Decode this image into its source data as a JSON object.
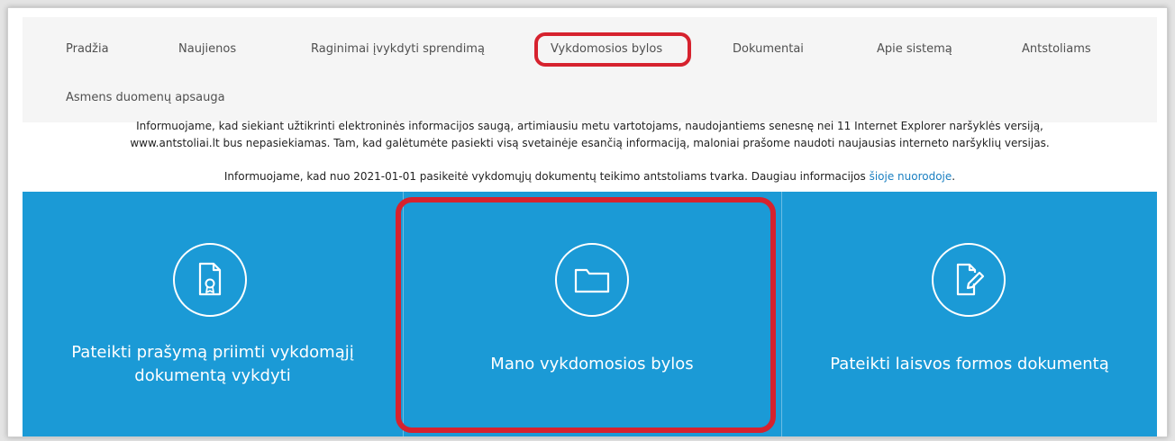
{
  "nav": {
    "items": [
      "Pradžia",
      "Naujienos",
      "Raginimai įvykdyti sprendimą",
      "Vykdomosios bylos",
      "Dokumentai",
      "Apie sistemą",
      "Antstoliams",
      "Asmens duomenų apsauga"
    ],
    "highlighted": "Vykdomosios bylos"
  },
  "notices": {
    "browser_line1": "Informuojame, kad siekiant užtikrinti elektroninės informacijos saugą, artimiausiu metu vartotojams, naudojantiems senesnę nei 11 Internet Explorer naršyklės versiją,",
    "browser_line2": "www.antstoliai.lt bus nepasiekiamas. Tam, kad galėtumėte pasiekti visą svetainėje esančią informaciją, maloniai prašome naudoti naujausias interneto naršyklių versijas.",
    "procedure_text": "Informuojame, kad nuo 2021-01-01 pasikeitė vykdomųjų dokumentų teikimo antstoliams tvarka. Daugiau informacijos ",
    "procedure_link": "šioje nuorodoje",
    "procedure_end": "."
  },
  "tiles": [
    {
      "label_line1": "Pateikti prašymą priimti vykdomąjį",
      "label_line2": "dokumentą vykdyti",
      "icon": "document-certificate-icon"
    },
    {
      "label_line1": "Mano vykdomosios bylos",
      "label_line2": "",
      "icon": "folder-icon"
    },
    {
      "label_line1": "Pateikti laisvos formos dokumentą",
      "label_line2": "",
      "icon": "document-edit-icon"
    }
  ],
  "colors": {
    "tile_background": "#1b9ad6",
    "highlight_border": "#d6222e",
    "link": "#1a7fc1"
  }
}
